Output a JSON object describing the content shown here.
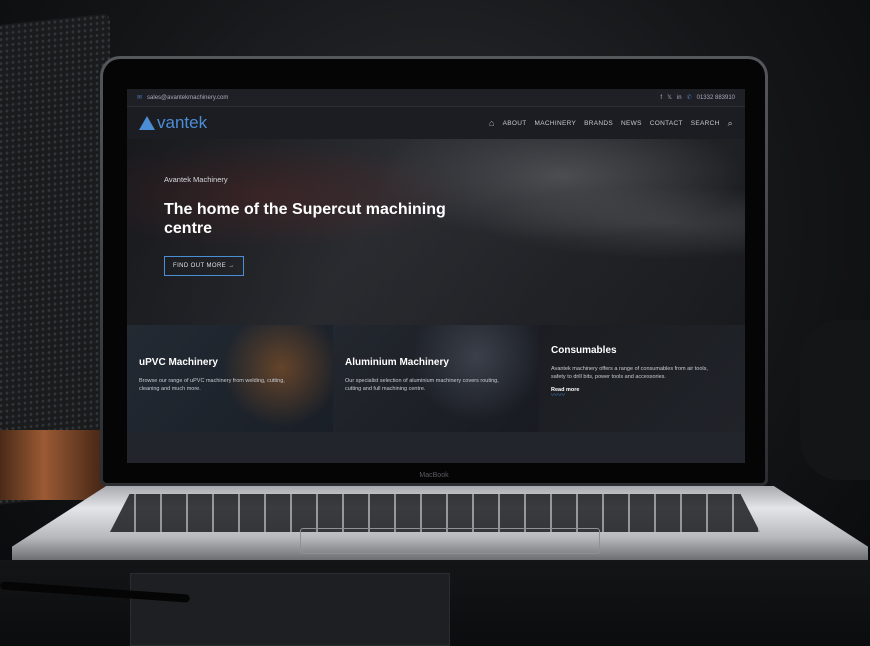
{
  "device": {
    "brand": "MacBook"
  },
  "topbar": {
    "email": "sales@avantekmachinery.com",
    "social": [
      "f",
      "🐦",
      "in"
    ],
    "phone": "01332 883910"
  },
  "nav": {
    "logo": "vantek",
    "items": [
      "ABOUT",
      "MACHINERY",
      "BRANDS",
      "NEWS",
      "CONTACT",
      "SEARCH"
    ]
  },
  "hero": {
    "kicker": "Avantek Machinery",
    "title": "The home of the Supercut machining centre",
    "button": "FIND OUT MORE →"
  },
  "cards": [
    {
      "title": "uPVC Machinery",
      "text": "Browse our range of uPVC machinery from welding, cutting, cleaning and much more."
    },
    {
      "title": "Aluminium Machinery",
      "text": "Our specialist selection of aluminium machinery covers routing, cutting and full machining centre."
    },
    {
      "title": "Consumables",
      "text": "Avantek machinery offers a range of consumables from air tools, safety to drill bits, power tools and accessories.",
      "link": "Read more"
    }
  ],
  "colors": {
    "accent": "#4c8ed6",
    "background": "#1a1c21"
  },
  "icons": [
    "mail-icon",
    "facebook-icon",
    "twitter-icon",
    "linkedin-icon",
    "phone-icon",
    "home-icon",
    "search-icon",
    "arrow-right-icon",
    "wave-icon"
  ]
}
